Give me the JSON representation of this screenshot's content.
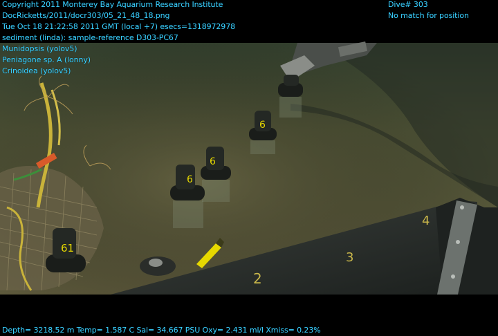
{
  "overlay": {
    "top_left": [
      "Copyright 2011 Monterey Bay Aquarium Research Institute",
      "DocRicketts/2011/docr303/05_21_48_18.png",
      "Tue Oct 18 21:22:58 2011 GMT (local +7)  esecs=1318972978",
      "sediment (linda): sample-reference D303-PC67",
      "Munidopsis (yolov5)",
      "Peniagone sp. A (lonny)",
      "Crinoidea (yolov5)"
    ],
    "top_right": [
      "Dive# 303",
      "No match for position"
    ],
    "bottom": "Depth= 3218.52 m  Temp= 1.587 C  Sal= 34.667 PSU  Oxy= 2.431 ml/l  Xmiss= 0.23%"
  },
  "scene": {
    "core_labels": [
      "61",
      "6",
      "6",
      "6",
      "61"
    ],
    "box_marks": [
      "4",
      "3",
      "2"
    ],
    "colors": {
      "overlay_text": "#3ad0ff",
      "sediment": "#5a5a3c",
      "water": "#2f3a2e",
      "tray": "#2a2f2c",
      "core_tube": "#1a1d1a",
      "marker_yellow": "#e6d800"
    }
  }
}
